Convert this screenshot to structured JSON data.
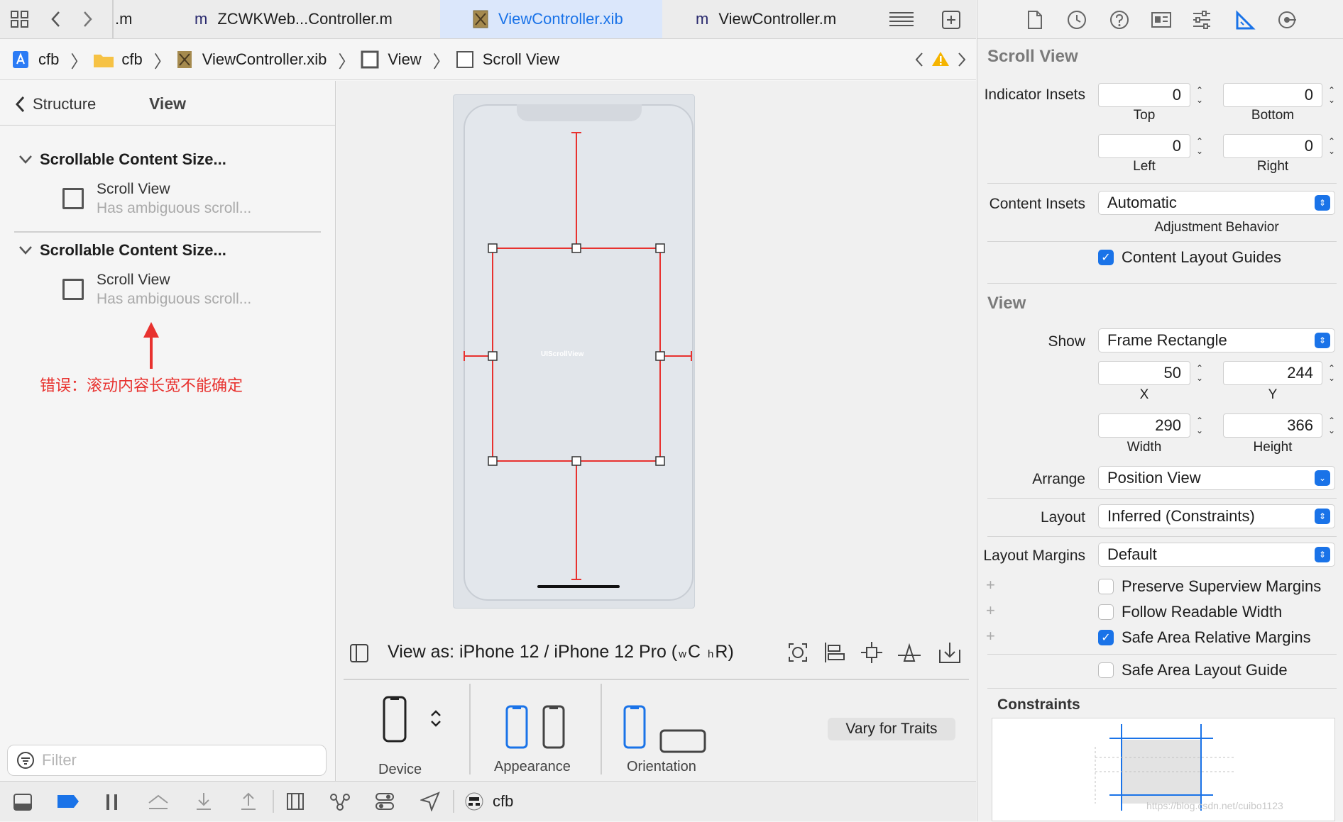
{
  "tabs": [
    {
      "label": ".m",
      "icon": "m-file-icon"
    },
    {
      "label": "ZCWKWeb...Controller.m",
      "icon": "m-file-icon"
    },
    {
      "label": "ViewController.xib",
      "icon": "xib-file-icon",
      "active": true
    },
    {
      "label": "ViewController.m",
      "icon": "m-file-icon"
    }
  ],
  "file_prefix": "m",
  "breadcrumb": [
    "cfb",
    "cfb",
    "ViewController.xib",
    "View",
    "Scroll View"
  ],
  "structure": {
    "back_label": "Structure",
    "title": "View",
    "groups": [
      {
        "heading": "Scrollable Content Size...",
        "item": "Scroll View",
        "detail": "Has ambiguous scroll..."
      },
      {
        "heading": "Scrollable Content Size...",
        "item": "Scroll View",
        "detail": "Has ambiguous scroll..."
      }
    ],
    "annotation": "错误：滚动内容长宽不能确定",
    "filter_placeholder": "Filter"
  },
  "canvas": {
    "scroll_view_label": "UIScrollView",
    "view_as": "View as: iPhone 12 / iPhone 12 Pro (",
    "size_w": "w",
    "size_c": "C",
    "size_h": "h",
    "size_r": "R)",
    "device_label": "Device",
    "appearance_label": "Appearance",
    "orientation_label": "Orientation",
    "vary_button": "Vary for Traits"
  },
  "inspector": {
    "scroll_title": "Scroll View",
    "indicator_label": "Indicator Insets",
    "indicator": {
      "top": "0",
      "bottom": "0",
      "left": "0",
      "right": "0"
    },
    "top_label": "Top",
    "bottom_label": "Bottom",
    "left_label": "Left",
    "right_label": "Right",
    "content_insets_label": "Content Insets",
    "content_insets_value": "Automatic",
    "adjustment_label": "Adjustment Behavior",
    "content_layout_guides": "Content Layout Guides",
    "view_title": "View",
    "show_label": "Show",
    "show_value": "Frame Rectangle",
    "x": "50",
    "y": "244",
    "width": "290",
    "height": "366",
    "x_label": "X",
    "y_label": "Y",
    "width_label": "Width",
    "height_label": "Height",
    "arrange_label": "Arrange",
    "arrange_value": "Position View",
    "layout_label": "Layout",
    "layout_value": "Inferred (Constraints)",
    "margins_label": "Layout Margins",
    "margins_value": "Default",
    "preserve": "Preserve Superview Margins",
    "follow": "Follow Readable Width",
    "safe_rel": "Safe Area Relative Margins",
    "safe_guide": "Safe Area Layout Guide",
    "constraints_title": "Constraints",
    "watermark": "https://blog.csdn.net/cuibo1123"
  },
  "bottom": {
    "scheme": "cfb"
  },
  "colors": {
    "accent": "#1a73e8",
    "error": "#e8322f",
    "warning": "#f5b400"
  }
}
